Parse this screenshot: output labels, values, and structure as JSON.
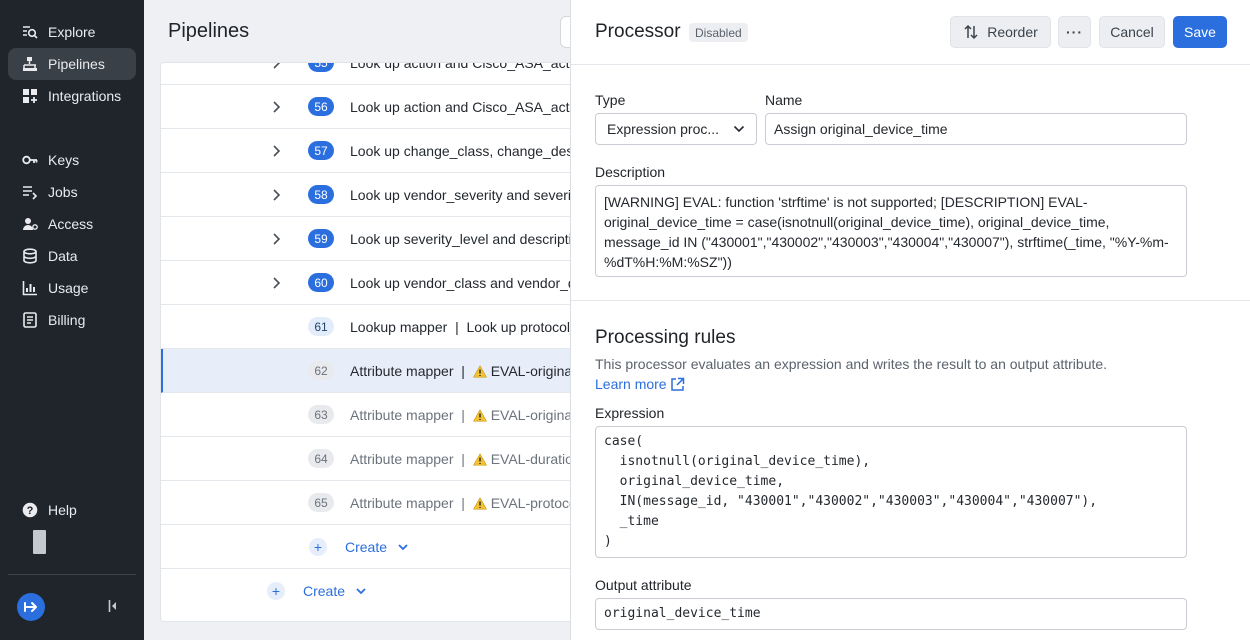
{
  "sidebar": {
    "items": [
      {
        "label": "Explore",
        "icon": "explore-icon"
      },
      {
        "label": "Pipelines",
        "icon": "pipelines-icon"
      },
      {
        "label": "Integrations",
        "icon": "integrations-icon"
      },
      {
        "label": "Keys",
        "icon": "key-icon"
      },
      {
        "label": "Jobs",
        "icon": "jobs-icon"
      },
      {
        "label": "Access",
        "icon": "access-icon"
      },
      {
        "label": "Data",
        "icon": "database-icon"
      },
      {
        "label": "Usage",
        "icon": "usage-icon"
      },
      {
        "label": "Billing",
        "icon": "billing-icon"
      }
    ],
    "help_label": "Help",
    "accent_color": "#2b6fde"
  },
  "main": {
    "title": "Pipelines",
    "rows": [
      {
        "num": "55",
        "text": "Look up action and Cisco_ASA_action"
      },
      {
        "num": "56",
        "text": "Look up action and Cisco_ASA_action"
      },
      {
        "num": "57",
        "text": "Look up change_class, change_description"
      },
      {
        "num": "58",
        "text": "Look up vendor_severity and severity"
      },
      {
        "num": "59",
        "text": "Look up severity_level and description"
      },
      {
        "num": "60",
        "text": "Look up vendor_class and vendor_description"
      },
      {
        "num": "61",
        "text": "Lookup mapper  |  Look up protocol_name"
      },
      {
        "num": "62",
        "text": "Attribute mapper  |  ⚠ EVAL-original_device_time"
      },
      {
        "num": "63",
        "text": "Attribute mapper  |  ⚠ EVAL-original_time"
      },
      {
        "num": "64",
        "text": "Attribute mapper  |  ⚠ EVAL-duration"
      },
      {
        "num": "65",
        "text": "Attribute mapper  |  ⚠ EVAL-protocol"
      }
    ],
    "row_types": {
      "r61_type": "Lookup mapper",
      "r61_rest": "Look up protocol_name",
      "r62_type": "Attribute mapper",
      "r62_rest": "EVAL-original_device_time",
      "r63_type": "Attribute mapper",
      "r63_rest": "EVAL-original_time",
      "r64_type": "Attribute mapper",
      "r64_rest": "EVAL-duration",
      "r65_type": "Attribute mapper",
      "r65_rest": "EVAL-protocol"
    },
    "separator": "|",
    "create_label": "Create"
  },
  "panel": {
    "title": "Processor",
    "status_badge": "Disabled",
    "reorder_label": "Reorder",
    "more_label": "···",
    "cancel_label": "Cancel",
    "save_label": "Save",
    "type_label": "Type",
    "type_value": "Expression proc...",
    "name_label": "Name",
    "name_value": "Assign original_device_time",
    "description_label": "Description",
    "description_value": "[WARNING] EVAL: function 'strftime' is not supported; [DESCRIPTION] EVAL-original_device_time = case(isnotnull(original_device_time), original_device_time, message_id IN (\"430001\",\"430002\",\"430003\",\"430004\",\"430007\"), strftime(_time, \"%Y-%m-%dT%H:%M:%SZ\"))",
    "rules_title": "Processing rules",
    "rules_desc": "This processor evaluates an expression and writes the result to an output attribute.",
    "learn_more": "Learn more",
    "expression_label": "Expression",
    "expression_value": "case(\n  isnotnull(original_device_time),\n  original_device_time,\n  IN(message_id, \"430001\",\"430002\",\"430003\",\"430004\",\"430007\"),\n  _time\n)",
    "output_label": "Output attribute",
    "output_value": "original_device_time"
  }
}
